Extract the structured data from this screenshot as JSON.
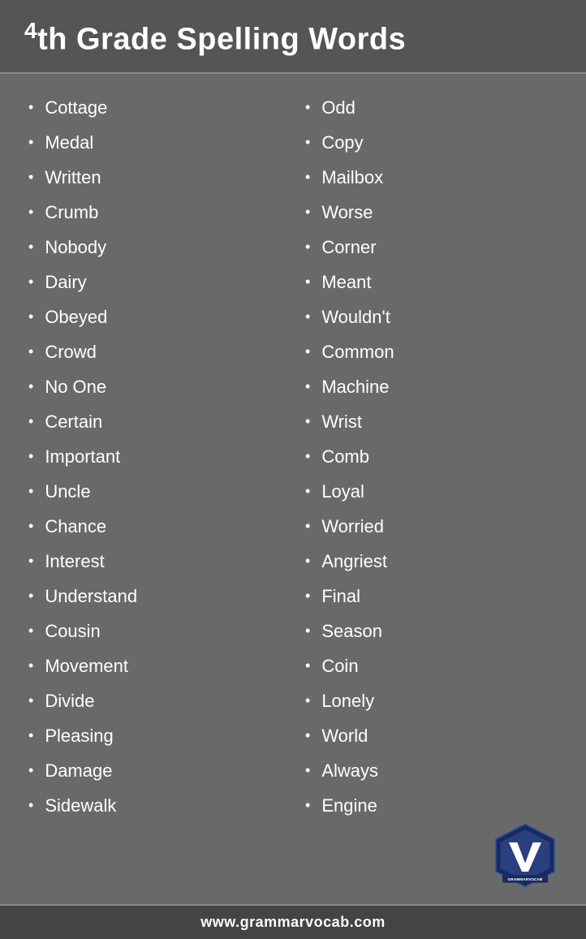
{
  "header": {
    "title_prefix": "4",
    "title_main": "th Grade Spelling Words"
  },
  "columns": {
    "left": [
      "Cottage",
      "Medal",
      "Written",
      "Crumb",
      "Nobody",
      "Dairy",
      "Obeyed",
      "Crowd",
      "No One",
      "Certain",
      "Important",
      "Uncle",
      "Chance",
      "Interest",
      "Understand",
      "Cousin",
      "Movement",
      "Divide",
      "Pleasing",
      "Damage",
      "Sidewalk"
    ],
    "right": [
      "Odd",
      "Copy",
      "Mailbox",
      "Worse",
      "Corner",
      "Meant",
      "Wouldn't",
      "Common",
      "Machine",
      "Wrist",
      "Comb",
      "Loyal",
      "Worried",
      "Angriest",
      "Final",
      "Season",
      "Coin",
      "Lonely",
      "World",
      "Always",
      "Engine"
    ]
  },
  "footer": {
    "url": "www.grammarvocab.com"
  },
  "logo": {
    "alt": "GrammarVocab Logo"
  },
  "colors": {
    "header_bg": "#555555",
    "body_bg": "#696969",
    "footer_bg": "#444444",
    "text": "#ffffff",
    "logo_dark_blue": "#1a2a5e",
    "logo_mid_blue": "#2a3f7f",
    "logo_border": "#888888"
  }
}
